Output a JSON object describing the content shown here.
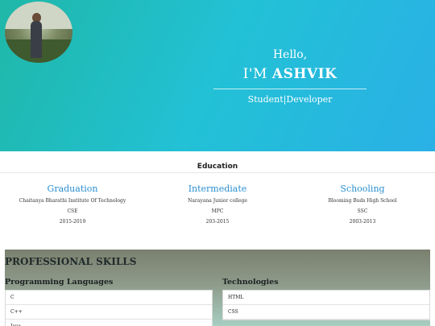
{
  "hero": {
    "hello": "Hello,",
    "name_prefix": "I'M",
    "name": "ASHVIK",
    "role": "Student|Developer",
    "gradient_colors": [
      "#1fb8a8",
      "#22c1d6",
      "#2ab0e6"
    ]
  },
  "education": {
    "title": "Education",
    "items": [
      {
        "heading": "Graduation",
        "institution": "Chaitanya Bharathi Institute Of Technology",
        "course": "CSE",
        "years": "2015-2019"
      },
      {
        "heading": "Intermediate",
        "institution": "Narayana Junior college",
        "course": "MPC",
        "years": "203-2015"
      },
      {
        "heading": "Schooling",
        "institution": "Blooming Buds High School",
        "course": "SSC",
        "years": "2003-2013"
      }
    ]
  },
  "skills": {
    "title": "PROFESSIONAL SKILLS",
    "programming": {
      "heading": "Programming Languages",
      "items": [
        "C",
        "C++",
        "Java"
      ]
    },
    "technologies": {
      "heading": "Technologies",
      "items": [
        "HTML",
        "CSS"
      ]
    }
  },
  "colors": {
    "accent": "#2a8fd0"
  }
}
